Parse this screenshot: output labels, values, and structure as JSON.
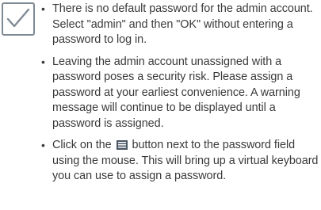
{
  "notes": {
    "item1": "There is no default password for the admin account. Select \"admin\" and then \"OK\" without entering a password to log in.",
    "item2": "Leaving the admin account unassigned with a password poses a security risk. Please assign a password at your earliest convenience. A warning message will continue to be displayed until a password is assigned.",
    "item3_before": "Click on the",
    "item3_after": "button next to the password field using the mouse. This will bring up a virtual keyboard you can use to assign a password."
  },
  "icons": {
    "note": "check-mark-icon",
    "keyboard": "virtual-keyboard-icon"
  },
  "colors": {
    "text": "#3a3a3a",
    "check_border": "#7f8a95",
    "icon_fill": "#4a5663"
  }
}
